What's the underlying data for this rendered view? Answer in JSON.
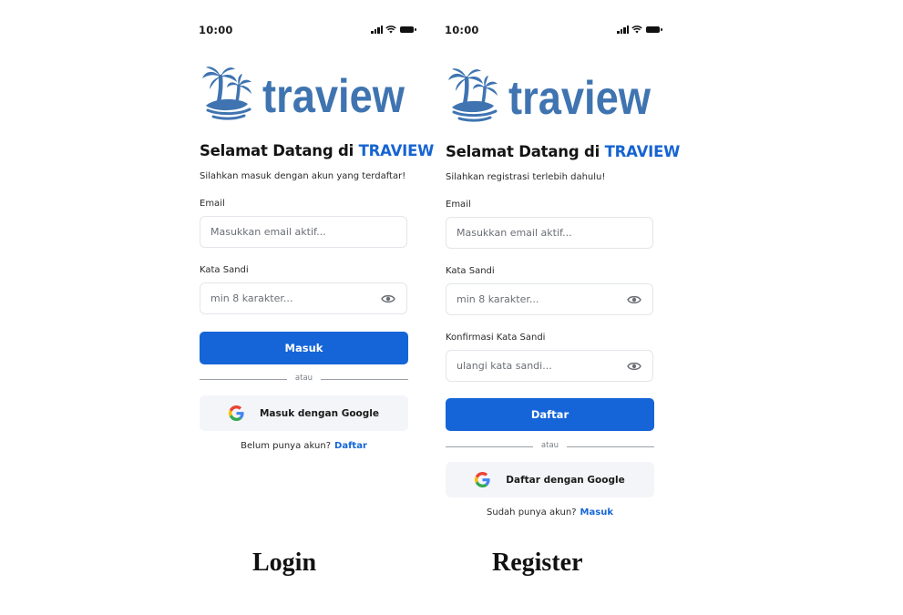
{
  "status_bar": {
    "time": "10:00"
  },
  "brand": {
    "name": "traview",
    "color": "#3f74b1",
    "icon": "palm-tree-island-icon"
  },
  "login": {
    "title_prefix": "Selamat Datang di",
    "title_brand": "TRAVIEW",
    "subtitle": "Silahkan masuk dengan akun yang terdaftar!",
    "email_label": "Email",
    "email_placeholder": "Masukkan email aktif...",
    "password_label": "Kata Sandi",
    "password_placeholder": "min 8 karakter...",
    "submit_label": "Masuk",
    "divider": "atau",
    "google_label": "Masuk dengan Google",
    "footer_text": "Belum punya akun?",
    "footer_link": "Daftar"
  },
  "register": {
    "title_prefix": "Selamat Datang di",
    "title_brand": "TRAVIEW",
    "subtitle": "Silahkan registrasi terlebih dahulu!",
    "email_label": "Email",
    "email_placeholder": "Masukkan email aktif...",
    "password_label": "Kata Sandi",
    "password_placeholder": "min 8 karakter...",
    "confirm_label": "Konfirmasi Kata Sandi",
    "confirm_placeholder": "ulangi kata sandi...",
    "submit_label": "Daftar",
    "divider": "atau",
    "google_label": "Daftar dengan Google",
    "footer_text": "Sudah punya akun?",
    "footer_link": "Masuk"
  },
  "captions": {
    "login": "Login",
    "register": "Register"
  },
  "colors": {
    "primary": "#1565d8",
    "brand_title": "#1664d1",
    "google_bg": "#f4f5f8"
  }
}
